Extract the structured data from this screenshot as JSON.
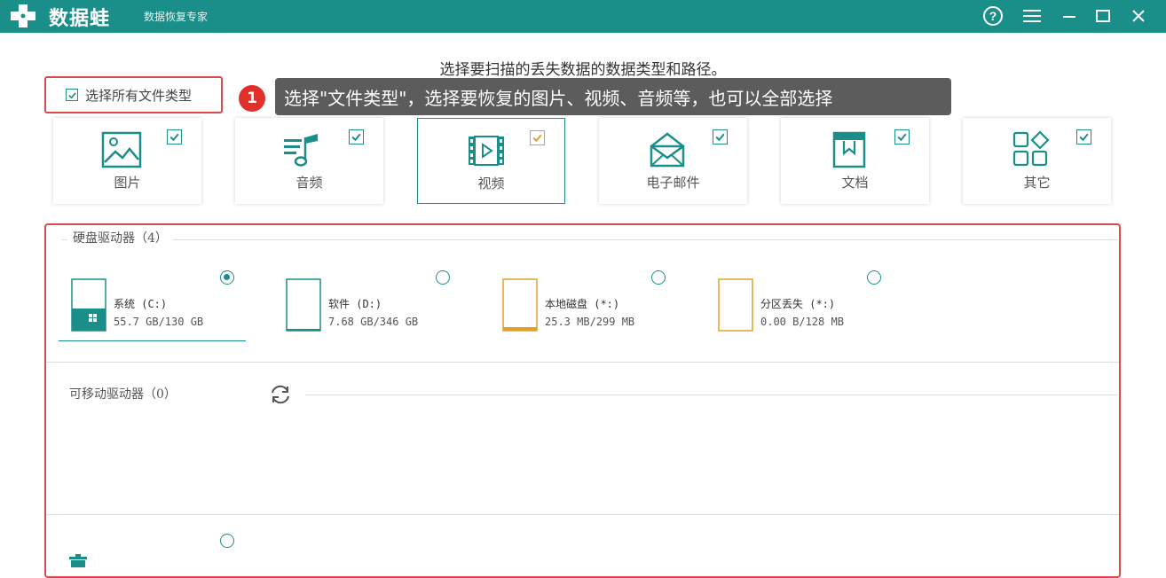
{
  "app": {
    "name": "数据蛙",
    "subtitle": "数据恢复专家",
    "brand_color": "#1a8f8a"
  },
  "titlebar": {
    "icons": [
      "help-icon",
      "menu-icon",
      "minimize-icon",
      "maximize-icon",
      "close-icon"
    ]
  },
  "instruction": "选择要扫描的丢失数据的数据类型和路径。",
  "select_all": {
    "label": "选择所有文件类型",
    "checked": true
  },
  "annotation": {
    "number": "1",
    "text": "选择\"文件类型\"，选择要恢复的图片、视频、音频等，也可以全部选择",
    "highlight_color": "#d94a4a"
  },
  "file_types": [
    {
      "label": "图片",
      "icon": "image-icon",
      "checked": true,
      "selected": false
    },
    {
      "label": "音频",
      "icon": "music-icon",
      "checked": true,
      "selected": false
    },
    {
      "label": "视频",
      "icon": "video-icon",
      "checked": true,
      "selected": true
    },
    {
      "label": "电子邮件",
      "icon": "email-icon",
      "checked": true,
      "selected": false
    },
    {
      "label": "文档",
      "icon": "document-icon",
      "checked": true,
      "selected": false
    },
    {
      "label": "其它",
      "icon": "other-icon",
      "checked": true,
      "selected": false
    }
  ],
  "hard_drives": {
    "title": "硬盘驱动器（4）",
    "items": [
      {
        "name": "系统 (C:)",
        "size": "55.7 GB/130 GB",
        "selected": true,
        "usage": 0.43,
        "icon": "system-drive-icon"
      },
      {
        "name": "软件 (D:)",
        "size": "7.68 GB/346 GB",
        "selected": false,
        "usage": 0.02,
        "icon": "drive-icon"
      },
      {
        "name": "本地磁盘 (*:)",
        "size": "25.3 MB/299 MB",
        "selected": false,
        "usage": 0.08,
        "icon": "drive-icon"
      },
      {
        "name": "分区丢失 (*:)",
        "size": "0.00  B/128 MB",
        "selected": false,
        "usage": 0,
        "icon": "drive-icon"
      }
    ]
  },
  "removable_drives": {
    "title": "可移动驱动器（0）",
    "refresh_icon": "refresh-icon"
  },
  "other_locations": {
    "icon": "recycle-bin-icon",
    "selected": false
  }
}
